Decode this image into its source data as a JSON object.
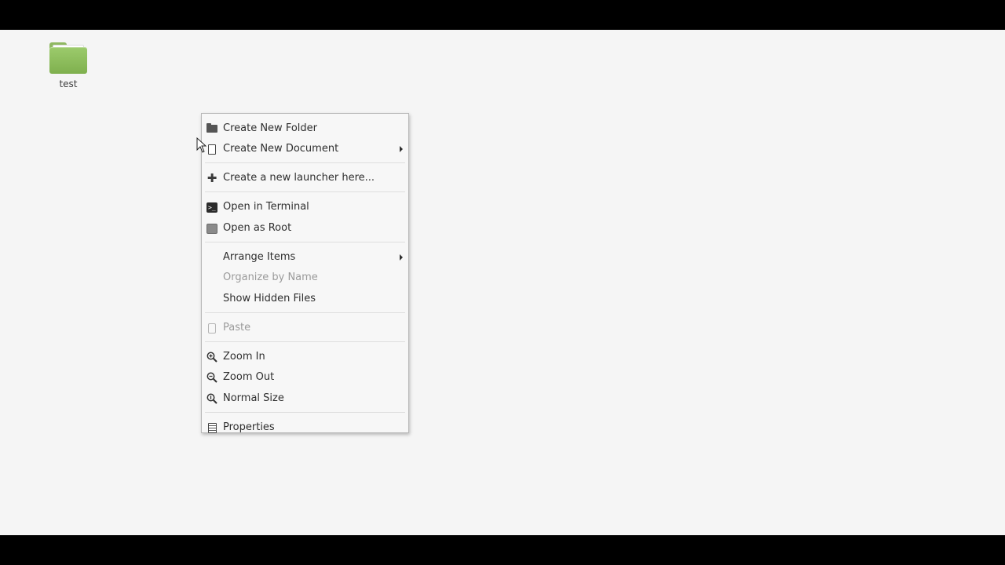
{
  "desktop": {
    "icons": [
      {
        "label": "test",
        "icon": "folder-icon",
        "color": "#8fbf5c"
      }
    ]
  },
  "context_menu": {
    "items": [
      {
        "label": "Create New Folder",
        "icon": "folder-new-icon",
        "disabled": false
      },
      {
        "label": "Create New Document",
        "icon": "document-icon",
        "submenu": true,
        "disabled": false
      },
      {
        "label": "Create a new launcher here...",
        "icon": "plus-icon",
        "disabled": false
      },
      {
        "label": "Open in Terminal",
        "icon": "terminal-icon",
        "disabled": false
      },
      {
        "label": "Open as Root",
        "icon": "root-icon",
        "disabled": false
      },
      {
        "label": "Arrange Items",
        "icon": "",
        "submenu": true,
        "disabled": false
      },
      {
        "label": "Organize by Name",
        "icon": "",
        "disabled": true
      },
      {
        "label": "Show Hidden Files",
        "icon": "",
        "disabled": false
      },
      {
        "label": "Paste",
        "icon": "paste-icon",
        "disabled": true
      },
      {
        "label": "Zoom In",
        "icon": "zoom-in-icon",
        "disabled": false
      },
      {
        "label": "Zoom Out",
        "icon": "zoom-out-icon",
        "disabled": false
      },
      {
        "label": "Normal Size",
        "icon": "zoom-normal-icon",
        "disabled": false
      },
      {
        "label": "Properties",
        "icon": "properties-icon",
        "disabled": false
      }
    ]
  },
  "colors": {
    "desktop_background": "#f5f5f5",
    "menu_background": "#f7f7f7",
    "text": "#2e2e2e",
    "disabled_text": "#9a9a9a",
    "folder_green": "#8fbf5c"
  }
}
